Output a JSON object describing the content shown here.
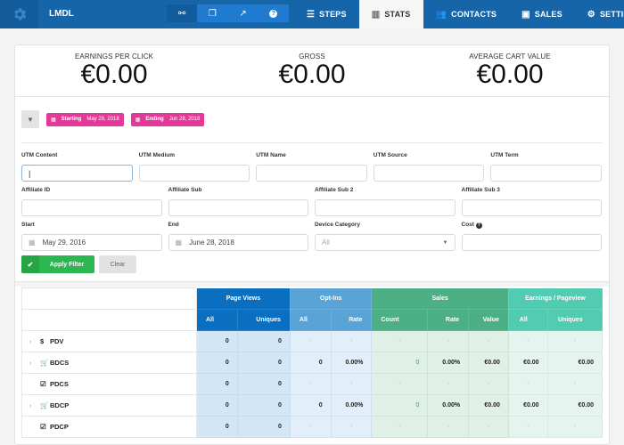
{
  "app": {
    "brand": "LMDL",
    "logo_icon": "gear-icon"
  },
  "toolbar": {
    "icons": [
      {
        "name": "link-icon",
        "glyph": "🔗",
        "active": true
      },
      {
        "name": "copy-icon",
        "glyph": "❐",
        "active": false
      },
      {
        "name": "external-link-icon",
        "glyph": "⇱",
        "active": false
      },
      {
        "name": "help-icon",
        "glyph": "?",
        "active": false
      }
    ]
  },
  "nav": {
    "tabs": [
      {
        "label": "STEPS",
        "icon": "☰",
        "icon_name": "list-icon",
        "active": false
      },
      {
        "label": "STATS",
        "icon": "▥",
        "icon_name": "bar-chart-icon",
        "active": true
      },
      {
        "label": "CONTACTS",
        "icon": "👥",
        "icon_name": "users-icon",
        "active": false
      },
      {
        "label": "SALES",
        "icon": "▣",
        "icon_name": "money-icon",
        "active": false
      },
      {
        "label": "SETTINGS",
        "icon": "⚙",
        "icon_name": "gear-icon",
        "active": false
      }
    ]
  },
  "kpis": [
    {
      "label": "EARNINGS PER CLICK",
      "value": "€0.00"
    },
    {
      "label": "GROSS",
      "value": "€0.00"
    },
    {
      "label": "AVERAGE CART VALUE",
      "value": "€0.00"
    }
  ],
  "filter_pills": {
    "starting": {
      "key": "Starting",
      "value": "May 29, 2018"
    },
    "ending": {
      "key": "Ending",
      "value": "Jun 28, 2018"
    }
  },
  "form": {
    "utm_content": {
      "label": "UTM Content",
      "value": ""
    },
    "utm_medium": {
      "label": "UTM Medium",
      "value": ""
    },
    "utm_name": {
      "label": "UTM Name",
      "value": ""
    },
    "utm_source": {
      "label": "UTM Source",
      "value": ""
    },
    "utm_term": {
      "label": "UTM Term",
      "value": ""
    },
    "affiliate_id": {
      "label": "Affiliate ID",
      "value": ""
    },
    "affiliate_sub": {
      "label": "Affiliate Sub",
      "value": ""
    },
    "affiliate_sub2": {
      "label": "Affiliate Sub 2",
      "value": ""
    },
    "affiliate_sub3": {
      "label": "Affiliate Sub 3",
      "value": ""
    },
    "start": {
      "label": "Start",
      "value": "May 29, 2016"
    },
    "end": {
      "label": "End",
      "value": "June 28, 2018"
    },
    "device_category": {
      "label": "Device Category",
      "value": "All"
    },
    "cost": {
      "label": "Cost",
      "value": ""
    },
    "apply_label": "Apply Filter",
    "clear_label": "Clear"
  },
  "table": {
    "groups": [
      "Page Views",
      "Opt-Ins",
      "Sales",
      "Earnings / Pageview"
    ],
    "subheaders": [
      "All",
      "Uniques",
      "All",
      "Rate",
      "Count",
      "Rate",
      "Value",
      "All",
      "Uniques"
    ],
    "rows": [
      {
        "name": "PDV",
        "icon": "$",
        "icon_name": "dollar-icon",
        "expandable": true,
        "cells": [
          "0",
          "0",
          "-",
          "-",
          "-",
          "-",
          "-",
          "-",
          "-"
        ]
      },
      {
        "name": "BDCS",
        "icon": "🛒",
        "icon_name": "cart-icon",
        "expandable": true,
        "cells": [
          "0",
          "0",
          "0",
          "0.00%",
          "0",
          "0.00%",
          "€0.00",
          "€0.00",
          "€0.00"
        ]
      },
      {
        "name": "PDCS",
        "icon": "☑",
        "icon_name": "checkbox-icon",
        "expandable": false,
        "cells": [
          "0",
          "0",
          "-",
          "-",
          "-",
          "-",
          "-",
          "-",
          "-"
        ]
      },
      {
        "name": "BDCP",
        "icon": "🛒",
        "icon_name": "cart-icon",
        "expandable": true,
        "cells": [
          "0",
          "0",
          "0",
          "0.00%",
          "0",
          "0.00%",
          "€0.00",
          "€0.00",
          "€0.00"
        ]
      },
      {
        "name": "PDCP",
        "icon": "☑",
        "icon_name": "checkbox-icon",
        "expandable": false,
        "cells": [
          "0",
          "0",
          "-",
          "-",
          "-",
          "-",
          "-",
          "-",
          "-"
        ]
      }
    ]
  }
}
